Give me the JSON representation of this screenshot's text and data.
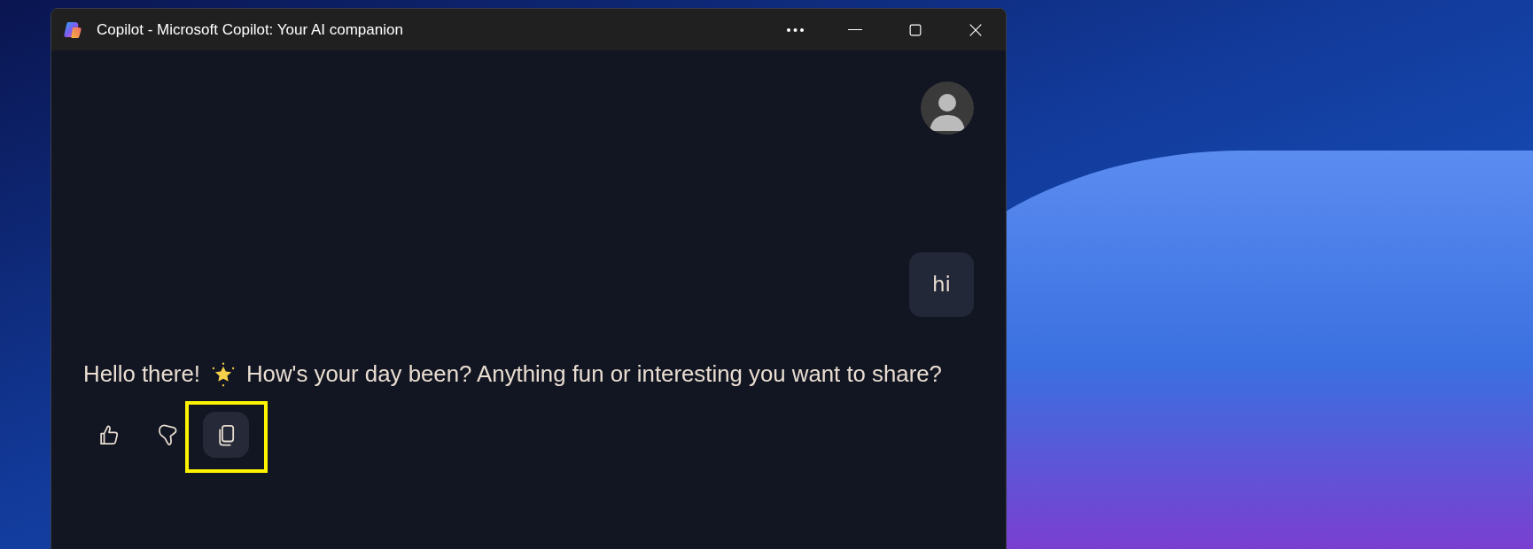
{
  "window": {
    "title": "Copilot - Microsoft Copilot: Your AI companion"
  },
  "title_bar": {
    "buttons": [
      {
        "kind": "more"
      },
      {
        "kind": "minimize"
      },
      {
        "kind": "maximize"
      },
      {
        "kind": "close"
      }
    ]
  },
  "chat": {
    "user_message": "hi",
    "reply": {
      "before_icon": "Hello there!",
      "after_icon": "How's your day been? Anything fun or interesting you want to share?"
    },
    "actions": [
      {
        "kind": "thumbs-up",
        "hovered": false,
        "outlined": false
      },
      {
        "kind": "thumbs-down",
        "hovered": false,
        "outlined": false
      },
      {
        "kind": "copy",
        "hovered": true,
        "outlined": true
      }
    ]
  }
}
